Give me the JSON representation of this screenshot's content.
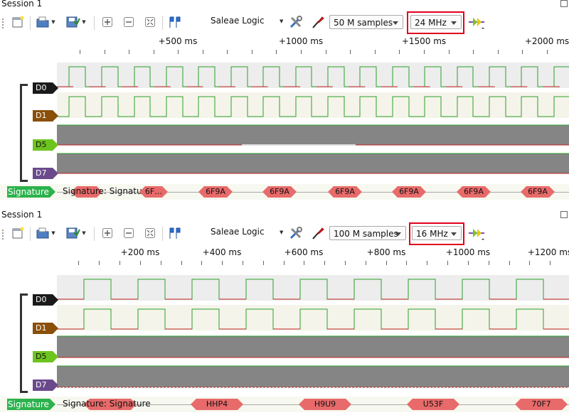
{
  "sessions": [
    {
      "title": "Session 1",
      "device": "Saleae Logic",
      "samples": "50 M samples",
      "rate": "24 MHz",
      "ruler": [
        "+500 ms",
        "+1000 ms",
        "+1500 ms",
        "+2000 ms"
      ],
      "channels": [
        "D0",
        "D1",
        "D5",
        "D7"
      ],
      "signature_label": "Signature",
      "signature_text": "Signature: Signature",
      "packets": [
        "6F…",
        "6F9A",
        "6F9A",
        "6F9A",
        "6F9A",
        "6F9A",
        "6F9A"
      ]
    },
    {
      "title": "Session 1",
      "device": "Saleae Logic",
      "samples": "100 M samples",
      "rate": "16 MHz",
      "ruler": [
        "+200 ms",
        "+400 ms",
        "+600 ms",
        "+800 ms",
        "+1000 ms",
        "+1200 ms"
      ],
      "channels": [
        "D0",
        "D1",
        "D5",
        "D7"
      ],
      "signature_label": "Signature",
      "signature_text": "Signature: Signature",
      "packets": [
        "HHP4",
        "H9U9",
        "U53F",
        "70F7"
      ]
    }
  ],
  "icons": [
    "new-session-icon",
    "open-icon",
    "save-icon",
    "zoom-in-icon",
    "zoom-out-icon",
    "zoom-fit-icon",
    "marker-icon",
    "settings-icon",
    "probe-icon",
    "start-icon"
  ],
  "colors": {
    "highlight": "#e0001a",
    "signature": "#2bb24c",
    "packet": "#e86a6a",
    "wave_high": "#1fa51f",
    "wave_low": "#c02020"
  }
}
